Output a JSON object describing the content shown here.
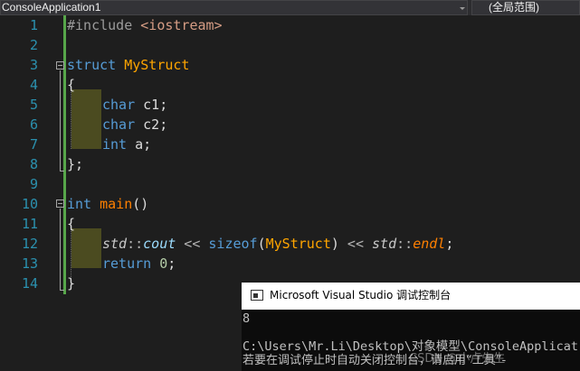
{
  "nav": {
    "project": "ConsoleApplication1",
    "scope": "(全局范围)"
  },
  "editor": {
    "line_numbers": [
      "1",
      "2",
      "3",
      "4",
      "5",
      "6",
      "7",
      "8",
      "9",
      "10",
      "11",
      "12",
      "13",
      "14"
    ],
    "lines": {
      "l1_directive": "#include",
      "l1_header": "<iostream>",
      "l3_kw": "struct",
      "l3_name": "MyStruct",
      "l4": "{",
      "l5_type": "char",
      "l5_var": " c1;",
      "l6_type": "char",
      "l6_var": " c2;",
      "l7_type": "int",
      "l7_var": " a;",
      "l8": "};",
      "l10_type": "int",
      "l10_name": "main",
      "l10_paren": "()",
      "l11": "{",
      "l12_std1": "std",
      "l12_sep1": "::",
      "l12_cout": "cout",
      "l12_op1": " << ",
      "l12_sizeof": "sizeof",
      "l12_p1": "(",
      "l12_arg": "MyStruct",
      "l12_p2": ")",
      "l12_op2": " << ",
      "l12_std2": "std",
      "l12_sep2": "::",
      "l12_endl": "endl",
      "l12_semi": ";",
      "l13_kw": "return",
      "l13_num": "0",
      "l13_semi": ";",
      "l14": "}"
    }
  },
  "console": {
    "title": "Microsoft Visual Studio 调试控制台",
    "output_value": "8",
    "path_line": "C:\\Users\\Mr.Li\\Desktop\\对象模型\\ConsoleApplicat",
    "hint_line": "若要在调试停止时自动关闭控制台，请启用“工具”-"
  },
  "watermark": "CSDN @小卢先生"
}
